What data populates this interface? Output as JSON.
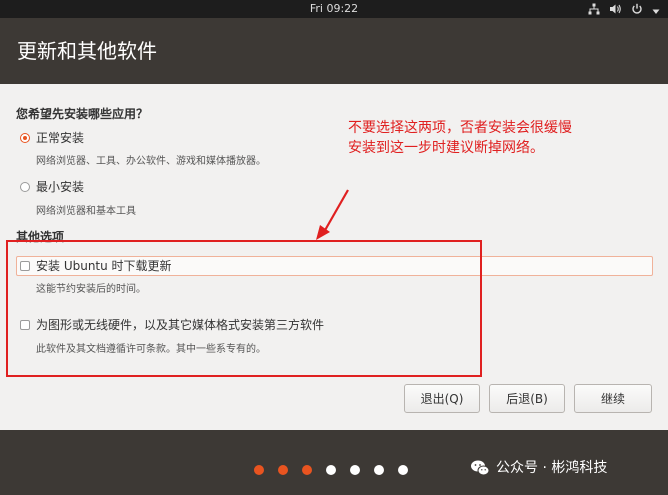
{
  "topbar": {
    "clock": "Fri 09:22"
  },
  "tray_icons": [
    "network-icon",
    "volume-icon",
    "power-icon",
    "chevron-down-icon"
  ],
  "window": {
    "title": "更新和其他软件"
  },
  "question": "您希望先安装哪些应用？",
  "install_options": [
    {
      "label": "正常安装",
      "description": "网络浏览器、工具、办公软件、游戏和媒体播放器。",
      "selected": true
    },
    {
      "label": "最小安装",
      "description": "网络浏览器和基本工具",
      "selected": false
    }
  ],
  "other_section": "其他选项",
  "other_options": [
    {
      "label": "安装 Ubuntu 时下载更新",
      "description": "这能节约安装后的时间。",
      "checked": false
    },
    {
      "label": "为图形或无线硬件，以及其它媒体格式安装第三方软件",
      "description": "此软件及其文档遵循许可条款。其中一些系专有的。",
      "checked": false
    }
  ],
  "annotation": {
    "line1": "不要选择这两项，否者安装会很缓慢",
    "line2": "安装到这一步时建议断掉网络。"
  },
  "buttons": {
    "quit": "退出(Q)",
    "back": "后退(B)",
    "continue": "继续"
  },
  "progress": {
    "completed_steps": 3,
    "total_steps": 7
  },
  "watermark": "公众号 · 彬鸿科技",
  "colors": {
    "accent": "#e95420",
    "annotation_red": "#e02020",
    "band": "#3d3935"
  }
}
